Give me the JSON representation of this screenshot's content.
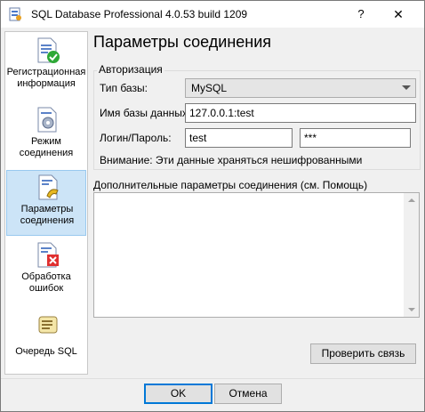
{
  "window": {
    "title": "SQL Database Professional 4.0.53 build 1209",
    "help_label": "?",
    "close_label": "✕",
    "icon": "app-icon"
  },
  "sidebar": {
    "items": [
      {
        "label": "Регистрационная информация",
        "icon": "document-checkmark-icon",
        "active": false
      },
      {
        "label": "Режим соединения",
        "icon": "document-gear-icon",
        "active": false
      },
      {
        "label": "Параметры соединения",
        "icon": "document-plug-icon",
        "active": true
      },
      {
        "label": "Обработка ошибок",
        "icon": "document-error-icon",
        "active": false
      },
      {
        "label": "Очередь SQL",
        "icon": "scroll-queue-icon",
        "active": false
      }
    ]
  },
  "main": {
    "title": "Параметры соединения",
    "auth_group": {
      "legend": "Авторизация",
      "db_type_label": "Тип базы:",
      "db_type_value": "MySQL",
      "db_name_label": "Имя базы данных:",
      "db_name_value": "127.0.0.1:test",
      "login_label": "Логин/Пароль:",
      "login_value": "test",
      "password_value": "***",
      "warning": "Внимание: Эти данные храняться нешифрованными"
    },
    "extra_params_label": "Дополнительные параметры соединения (см. Помощь)",
    "extra_params_value": "",
    "check_button": "Проверить связь"
  },
  "footer": {
    "ok": "OK",
    "cancel": "Отмена"
  },
  "colors": {
    "active_item_bg": "#cce4f7",
    "active_item_border": "#99c9ef",
    "default_button_border": "#0078d7",
    "window_bg": "#f0f0f0"
  }
}
